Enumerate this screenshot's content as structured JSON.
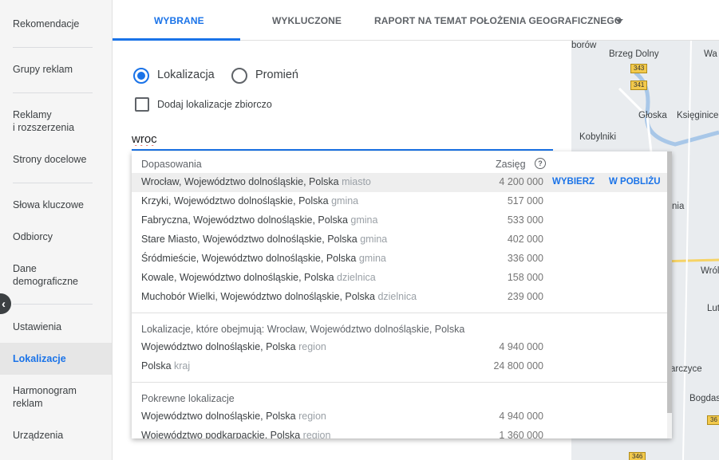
{
  "sidebar": {
    "items": [
      {
        "label": "Rekomendacje"
      },
      {
        "label": "Grupy reklam"
      },
      {
        "label": "Reklamy\ni rozszerzenia"
      },
      {
        "label": "Strony docelowe"
      },
      {
        "label": "Słowa kluczowe"
      },
      {
        "label": "Odbiorcy"
      },
      {
        "label": "Dane\ndemograficzne"
      },
      {
        "label": "Ustawienia"
      },
      {
        "label": "Lokalizacje"
      },
      {
        "label": "Harmonogram\nreklam"
      },
      {
        "label": "Urządzenia"
      }
    ],
    "active": "Lokalizacje",
    "collapse_glyph": "‹"
  },
  "tabs": [
    {
      "label": "WYBRANE",
      "active": true
    },
    {
      "label": "WYKLUCZONE",
      "active": false
    },
    {
      "label": "RAPORT NA TEMAT POŁOŻENIA GEOGRAFICZNEGO",
      "active": false
    }
  ],
  "form": {
    "radio_location": "Lokalizacja",
    "radio_radius": "Promień",
    "bulk_checkbox": "Dodaj lokalizacje zbiorczo",
    "search_value": "wroc"
  },
  "dropdown": {
    "header_matches": "Dopasowania",
    "header_reach": "Zasięg",
    "help_glyph": "?",
    "select_label": "WYBIERZ",
    "nearby_label": "W POBLIŻU",
    "matches": [
      {
        "name": "Wrocław, Województwo dolnośląskie, Polska",
        "type": "miasto",
        "reach": "4 200 000"
      },
      {
        "name": "Krzyki, Województwo dolnośląskie, Polska",
        "type": "gmina",
        "reach": "517 000"
      },
      {
        "name": "Fabryczna, Województwo dolnośląskie, Polska",
        "type": "gmina",
        "reach": "533 000"
      },
      {
        "name": "Stare Miasto, Województwo dolnośląskie, Polska",
        "type": "gmina",
        "reach": "402 000"
      },
      {
        "name": "Śródmieście, Województwo dolnośląskie, Polska",
        "type": "gmina",
        "reach": "336 000"
      },
      {
        "name": "Kowale, Województwo dolnośląskie, Polska",
        "type": "dzielnica",
        "reach": "158 000"
      },
      {
        "name": "Muchobór Wielki, Województwo dolnośląskie, Polska",
        "type": "dzielnica",
        "reach": "239 000"
      }
    ],
    "containing_header": "Lokalizacje, które obejmują: Wrocław, Województwo dolnośląskie, Polska",
    "containing": [
      {
        "name": "Województwo dolnośląskie, Polska",
        "type": "region",
        "reach": "4 940 000"
      },
      {
        "name": "Polska",
        "type": "kraj",
        "reach": "24 800 000"
      }
    ],
    "related_header": "Pokrewne lokalizacje",
    "related": [
      {
        "name": "Województwo dolnośląskie, Polska",
        "type": "region",
        "reach": "4 940 000"
      },
      {
        "name": "Województwo podkarpackie, Polska",
        "type": "region",
        "reach": "1 360 000"
      }
    ]
  },
  "map": {
    "labels": [
      "borów",
      "Brzeg Dolny",
      "Wa",
      "Głoska",
      "Księginice",
      "Kobylniki",
      "nia",
      "Wról",
      "Lut",
      "arczyce",
      "Bogdas"
    ],
    "badges": [
      "343",
      "341",
      "346",
      "36"
    ]
  }
}
